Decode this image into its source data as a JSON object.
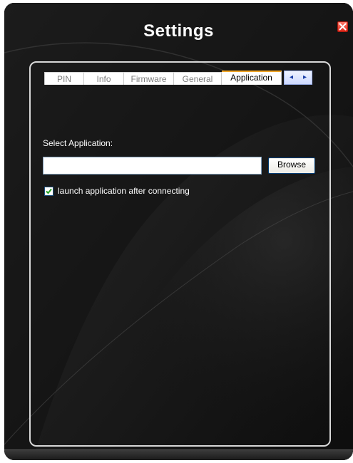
{
  "window": {
    "title": "Settings"
  },
  "tabs": [
    {
      "label": "PIN",
      "active": false
    },
    {
      "label": "Info",
      "active": false
    },
    {
      "label": "Firmware",
      "active": false
    },
    {
      "label": "General",
      "active": false
    },
    {
      "label": "Application",
      "active": true
    }
  ],
  "tab_scroll": {
    "left": "◂",
    "right": "▸"
  },
  "application": {
    "select_label": "Select Application:",
    "path_value": "",
    "browse_label": "Browse",
    "launch_checkbox_label": "launch application after connecting",
    "launch_checked": true
  },
  "colors": {
    "background": "#141414",
    "active_tab_accent": "#f0a526",
    "close_button": "#e0281a"
  }
}
